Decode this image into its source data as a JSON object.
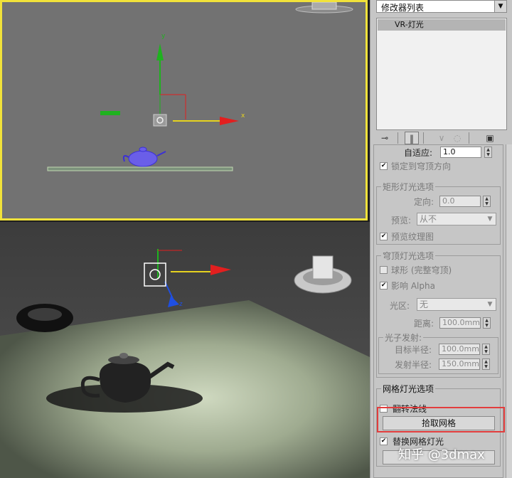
{
  "modifier_list": {
    "label": "修改器列表",
    "arrow": "▼"
  },
  "stack": {
    "selected_item": "VR-灯光"
  },
  "stack_toolbar": {
    "icons": [
      "pin-stack-icon",
      "show-end-result-icon",
      "make-unique-icon",
      "remove-modifier-icon",
      "configure-modifier-sets-icon"
    ]
  },
  "params": {
    "adaptive_label": "自适应:",
    "adaptive_value": "1.0",
    "lock_dome_label": "锁定到穹顶方向",
    "rect_group_title": "矩形灯光选项",
    "directional_label": "定向:",
    "directional_value": "0.0",
    "preview_label": "预览:",
    "preview_value": "从不",
    "preview_texture_label": "预览纹理图",
    "dome_group_title": "穹顶灯光选项",
    "spherical_label": "球形 (完整穹顶)",
    "affect_alpha_label": "影响 Alpha",
    "light_zone_label": "光区:",
    "light_zone_value": "无",
    "distance_label": "距离:",
    "distance_value": "100.0mm",
    "photon_group_title": "光子发射:",
    "target_radius_label": "目标半径:",
    "target_radius_value": "100.0mm",
    "emit_radius_label": "发射半径:",
    "emit_radius_value": "150.0mm",
    "mesh_group_title": "网格灯光选项",
    "flip_normals_label": "翻转法线",
    "pick_mesh_button": "拾取网格",
    "replace_mesh_label": "替换网格灯光"
  },
  "viewport_top": {
    "axis_x": "x",
    "axis_y": "y"
  },
  "viewport_persp": {
    "axis_z": "z"
  },
  "watermark": "知乎 @3dmax",
  "colors": {
    "active_viewport_border": "#f1e23a",
    "highlight_box": "#e23d3d",
    "axis_x": "#e21f1f",
    "axis_y": "#1fb21f",
    "axis_z": "#1f4fe2"
  }
}
